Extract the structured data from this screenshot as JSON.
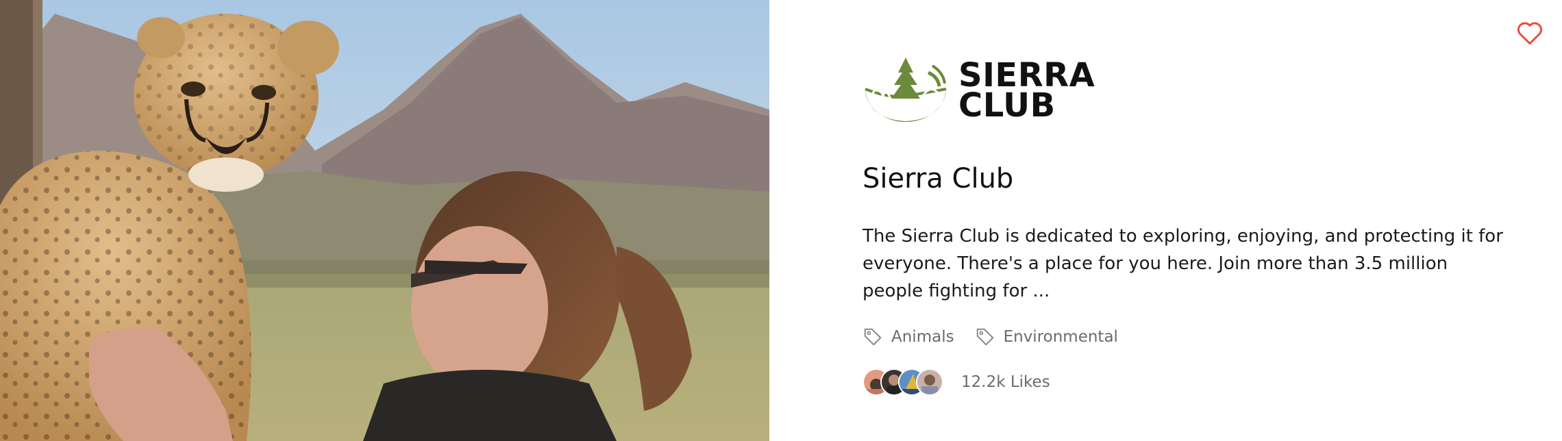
{
  "card": {
    "photo_alt": "cheetah cub and woman in front of mountains",
    "logo": {
      "line1": "SIERRA",
      "line2": "CLUB",
      "mark_color": "#6b8a3a"
    },
    "title": "Sierra Club",
    "description": "The Sierra Club is dedicated to exploring, enjoying, and protecting it for everyone. There's a place for you here. Join more than 3.5 million people fighting for ...",
    "tags": [
      {
        "label": "Animals",
        "icon": "tag-icon"
      },
      {
        "label": "Environmental",
        "icon": "tag-icon"
      }
    ],
    "likes": {
      "count_label": "12.2k Likes",
      "avatar_count": 4
    },
    "favorite_icon": "heart-icon",
    "colors": {
      "accent_heart": "#e8503a",
      "muted_text": "#6b6b6b"
    }
  }
}
